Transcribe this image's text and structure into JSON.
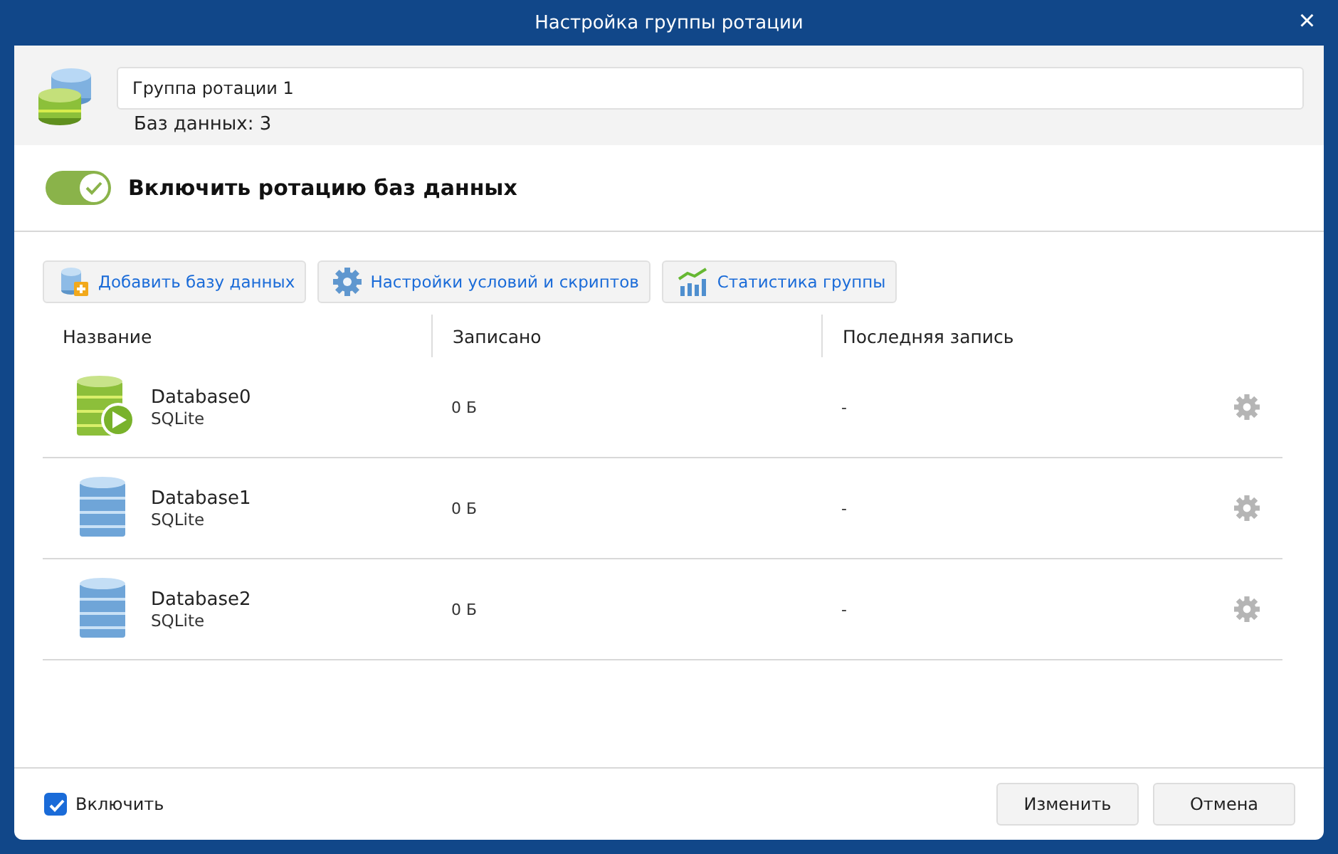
{
  "window": {
    "title": "Настройка группы ротации",
    "close": "×"
  },
  "group": {
    "name": "Группа ротации 1",
    "count": "Баз данных: 3"
  },
  "rotation_toggle": {
    "label": "Включить ротацию баз данных",
    "on": true
  },
  "toolbar": [
    {
      "kind": "add",
      "label": "Добавить базу данных"
    },
    {
      "kind": "settings",
      "label": "Настройки условий и скриптов"
    },
    {
      "kind": "stats",
      "label": "Статистика группы"
    }
  ],
  "table": {
    "columns": [
      "Название",
      "Записано",
      "Последняя запись"
    ],
    "rows": [
      {
        "name": "Database0",
        "type": "SQLite",
        "written": "0 Б",
        "last": "-",
        "running": true
      },
      {
        "name": "Database1",
        "type": "SQLite",
        "written": "0 Б",
        "last": "-",
        "running": false
      },
      {
        "name": "Database2",
        "type": "SQLite",
        "written": "0 Б",
        "last": "-",
        "running": false
      }
    ]
  },
  "footer": {
    "enable": {
      "label": "Включить",
      "checked": true
    },
    "buttons": [
      "Изменить",
      "Отмена"
    ]
  }
}
